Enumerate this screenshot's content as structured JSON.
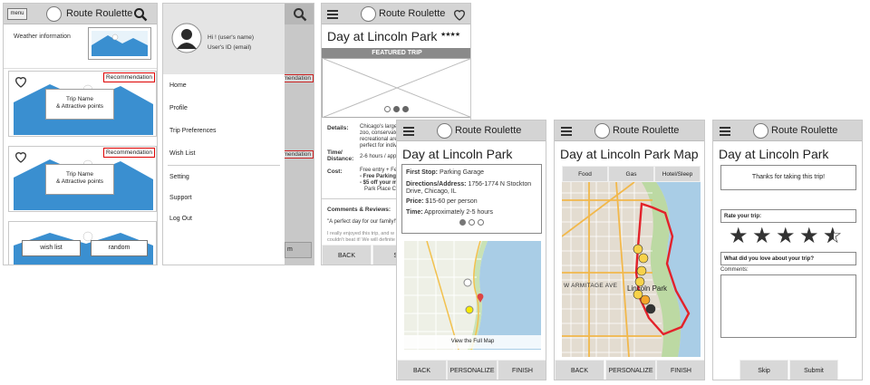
{
  "screen1": {
    "menu_label": "menu",
    "title": "Route Roulette",
    "weather": "Weather information",
    "cards": [
      {
        "badge": "Recommendation",
        "trip_name": "Trip Name",
        "trip_points": "& Attractive points"
      },
      {
        "badge": "Recommendation",
        "trip_name": "Trip Name",
        "trip_points": "& Attractive points"
      }
    ],
    "wish_list": "wish list",
    "random": "random"
  },
  "screen2": {
    "greeting": "Hi ! (user's name)",
    "user_id": "User's ID (email)",
    "menu": [
      "Home",
      "Profile",
      "Trip Preferences",
      "Wish List",
      "Setting",
      "Support",
      "Log Out"
    ],
    "peek_badge": "Recommendation"
  },
  "screen3": {
    "title": "Route Roulette",
    "page_title": "Day at Lincoln Park",
    "rating_stars": "★★★★",
    "featured": "FEATURED TRIP",
    "details_label": "Details:",
    "details_lines": [
      "Chicago's largest",
      "zoo, conservator",
      "recreational area",
      "perfect for indivi"
    ],
    "time_label": "Time/",
    "distance_label": "Distance:",
    "time_value": "2-6 hours / appr",
    "cost_label": "Cost:",
    "cost_lines": [
      "Free entry + Fea",
      "- Free Parking a",
      "- $5 off your me",
      "Park Place Cafe"
    ],
    "comments_title": "Comments & Reviews:",
    "comment1": "\"A perfect day for our family!\"",
    "comment2a": "I really enjoyed this trip, and w",
    "comment2b": "couldn't beat it! We will definite",
    "back": "BACK",
    "sk": "SK"
  },
  "screen4": {
    "title": "Route Roulette",
    "page_title": "Day at Lincoln Park",
    "first_stop_label": "First Stop:",
    "first_stop": "Parking Garage",
    "address_label": "Directions/Address:",
    "address": "1756-1774 N Stockton",
    "address2": "Drive, Chicago, IL",
    "price_label": "Price:",
    "price": "$15-60 per person",
    "time_label": "Time:",
    "time": "Approximately 2-5 hours",
    "view_map": "View the Full Map",
    "back": "BACK",
    "personalize": "PERSONALIZE",
    "finish": "FINISH"
  },
  "screen5": {
    "title": "Route Roulette",
    "page_title": "Day at Lincoln Park Map",
    "tabs": [
      "Food",
      "Gas",
      "Hotel/Sleep"
    ],
    "street": "W ARMITAGE AVE",
    "park": "Lincoln Park",
    "back": "BACK",
    "personalize": "PERSONALIZE",
    "finish": "FINISH"
  },
  "screen6": {
    "title": "Route Roulette",
    "page_title": "Day at Lincoln Park",
    "thanks": "Thanks for taking this trip!",
    "rate": "Rate your trip:",
    "rating": 4.5,
    "love": "What did you love about your trip?",
    "comments": "Comments:",
    "skip": "Skip",
    "submit": "Submit"
  }
}
